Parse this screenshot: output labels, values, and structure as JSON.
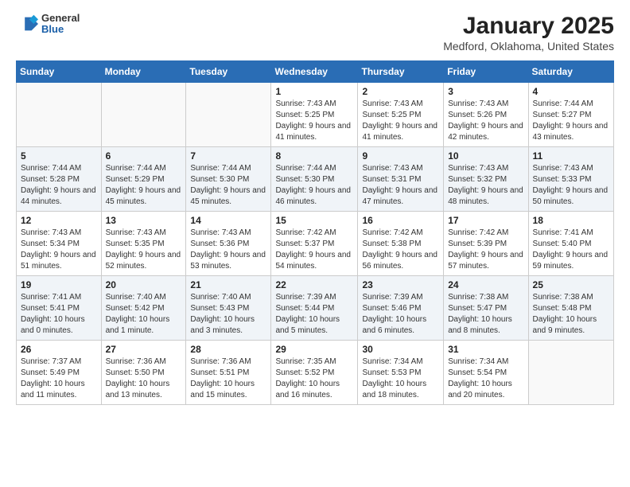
{
  "header": {
    "logo_general": "General",
    "logo_blue": "Blue",
    "month_title": "January 2025",
    "location": "Medford, Oklahoma, United States"
  },
  "weekdays": [
    "Sunday",
    "Monday",
    "Tuesday",
    "Wednesday",
    "Thursday",
    "Friday",
    "Saturday"
  ],
  "weeks": [
    [
      {
        "day": "",
        "info": ""
      },
      {
        "day": "",
        "info": ""
      },
      {
        "day": "",
        "info": ""
      },
      {
        "day": "1",
        "info": "Sunrise: 7:43 AM\nSunset: 5:25 PM\nDaylight: 9 hours and 41 minutes."
      },
      {
        "day": "2",
        "info": "Sunrise: 7:43 AM\nSunset: 5:25 PM\nDaylight: 9 hours and 41 minutes."
      },
      {
        "day": "3",
        "info": "Sunrise: 7:43 AM\nSunset: 5:26 PM\nDaylight: 9 hours and 42 minutes."
      },
      {
        "day": "4",
        "info": "Sunrise: 7:44 AM\nSunset: 5:27 PM\nDaylight: 9 hours and 43 minutes."
      }
    ],
    [
      {
        "day": "5",
        "info": "Sunrise: 7:44 AM\nSunset: 5:28 PM\nDaylight: 9 hours and 44 minutes."
      },
      {
        "day": "6",
        "info": "Sunrise: 7:44 AM\nSunset: 5:29 PM\nDaylight: 9 hours and 45 minutes."
      },
      {
        "day": "7",
        "info": "Sunrise: 7:44 AM\nSunset: 5:30 PM\nDaylight: 9 hours and 45 minutes."
      },
      {
        "day": "8",
        "info": "Sunrise: 7:44 AM\nSunset: 5:30 PM\nDaylight: 9 hours and 46 minutes."
      },
      {
        "day": "9",
        "info": "Sunrise: 7:43 AM\nSunset: 5:31 PM\nDaylight: 9 hours and 47 minutes."
      },
      {
        "day": "10",
        "info": "Sunrise: 7:43 AM\nSunset: 5:32 PM\nDaylight: 9 hours and 48 minutes."
      },
      {
        "day": "11",
        "info": "Sunrise: 7:43 AM\nSunset: 5:33 PM\nDaylight: 9 hours and 50 minutes."
      }
    ],
    [
      {
        "day": "12",
        "info": "Sunrise: 7:43 AM\nSunset: 5:34 PM\nDaylight: 9 hours and 51 minutes."
      },
      {
        "day": "13",
        "info": "Sunrise: 7:43 AM\nSunset: 5:35 PM\nDaylight: 9 hours and 52 minutes."
      },
      {
        "day": "14",
        "info": "Sunrise: 7:43 AM\nSunset: 5:36 PM\nDaylight: 9 hours and 53 minutes."
      },
      {
        "day": "15",
        "info": "Sunrise: 7:42 AM\nSunset: 5:37 PM\nDaylight: 9 hours and 54 minutes."
      },
      {
        "day": "16",
        "info": "Sunrise: 7:42 AM\nSunset: 5:38 PM\nDaylight: 9 hours and 56 minutes."
      },
      {
        "day": "17",
        "info": "Sunrise: 7:42 AM\nSunset: 5:39 PM\nDaylight: 9 hours and 57 minutes."
      },
      {
        "day": "18",
        "info": "Sunrise: 7:41 AM\nSunset: 5:40 PM\nDaylight: 9 hours and 59 minutes."
      }
    ],
    [
      {
        "day": "19",
        "info": "Sunrise: 7:41 AM\nSunset: 5:41 PM\nDaylight: 10 hours and 0 minutes."
      },
      {
        "day": "20",
        "info": "Sunrise: 7:40 AM\nSunset: 5:42 PM\nDaylight: 10 hours and 1 minute."
      },
      {
        "day": "21",
        "info": "Sunrise: 7:40 AM\nSunset: 5:43 PM\nDaylight: 10 hours and 3 minutes."
      },
      {
        "day": "22",
        "info": "Sunrise: 7:39 AM\nSunset: 5:44 PM\nDaylight: 10 hours and 5 minutes."
      },
      {
        "day": "23",
        "info": "Sunrise: 7:39 AM\nSunset: 5:46 PM\nDaylight: 10 hours and 6 minutes."
      },
      {
        "day": "24",
        "info": "Sunrise: 7:38 AM\nSunset: 5:47 PM\nDaylight: 10 hours and 8 minutes."
      },
      {
        "day": "25",
        "info": "Sunrise: 7:38 AM\nSunset: 5:48 PM\nDaylight: 10 hours and 9 minutes."
      }
    ],
    [
      {
        "day": "26",
        "info": "Sunrise: 7:37 AM\nSunset: 5:49 PM\nDaylight: 10 hours and 11 minutes."
      },
      {
        "day": "27",
        "info": "Sunrise: 7:36 AM\nSunset: 5:50 PM\nDaylight: 10 hours and 13 minutes."
      },
      {
        "day": "28",
        "info": "Sunrise: 7:36 AM\nSunset: 5:51 PM\nDaylight: 10 hours and 15 minutes."
      },
      {
        "day": "29",
        "info": "Sunrise: 7:35 AM\nSunset: 5:52 PM\nDaylight: 10 hours and 16 minutes."
      },
      {
        "day": "30",
        "info": "Sunrise: 7:34 AM\nSunset: 5:53 PM\nDaylight: 10 hours and 18 minutes."
      },
      {
        "day": "31",
        "info": "Sunrise: 7:34 AM\nSunset: 5:54 PM\nDaylight: 10 hours and 20 minutes."
      },
      {
        "day": "",
        "info": ""
      }
    ]
  ]
}
